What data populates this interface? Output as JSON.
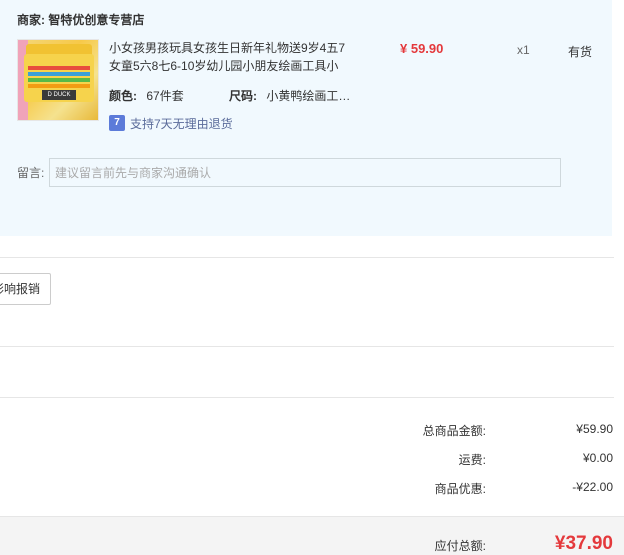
{
  "merchant": {
    "label": "商家:",
    "name": "智特优创意专营店"
  },
  "product": {
    "title": "小女孩男孩玩具女孩生日新年礼物送9岁4五7女童5六8七6-10岁幼儿园小朋友绘画工具小",
    "price": "¥ 59.90",
    "qty": "x1",
    "stock": "有货",
    "image_tag": "D DUCK",
    "color_label": "颜色:",
    "color_value": "67件套",
    "size_label": "尺码:",
    "size_value": "小黄鸭绘画工…",
    "return_icon": "7",
    "return_text": "支持7天无理由退货"
  },
  "remark": {
    "label": "留言:",
    "placeholder": "建议留言前先与商家沟通确认"
  },
  "expense_button": "影响报销",
  "summary": {
    "goods_total_label": "总商品金额:",
    "goods_total_value": "¥59.90",
    "shipping_label": "运费:",
    "shipping_value": "¥0.00",
    "discount_label": "商品优惠:",
    "discount_value": "-¥22.00",
    "payable_label": "应付总额:",
    "payable_value": "¥37.90"
  },
  "colors": {
    "price_red": "#e4393c",
    "panel_bg": "#f1f9fe",
    "badge_blue": "#5c7bd9"
  }
}
